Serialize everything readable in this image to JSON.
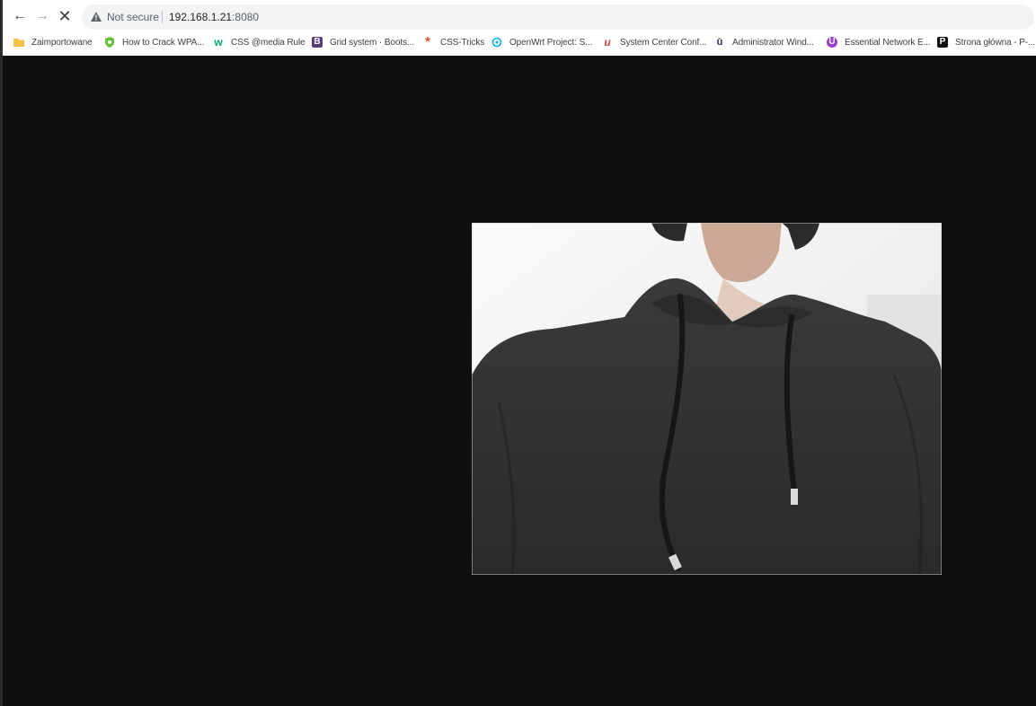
{
  "browser": {
    "security_label": "Not secure",
    "url_host": "192.168.1.21",
    "url_port": ":8080",
    "bookmarks": [
      {
        "label": "Zaimportowane",
        "icon": "folder-icon",
        "color": "#f6c244"
      },
      {
        "label": "How to Crack WPA...",
        "icon": "green-shield-icon",
        "color": "#6abf3a"
      },
      {
        "label": "CSS @media Rule",
        "icon": "w3schools-icon",
        "color": "#04aa6d"
      },
      {
        "label": "Grid system · Boots...",
        "icon": "bootstrap-icon",
        "color": "#563d7c"
      },
      {
        "label": "CSS-Tricks",
        "icon": "asterisk-icon",
        "color": "#e8542c"
      },
      {
        "label": "OpenWrt Project: S...",
        "icon": "openwrt-icon",
        "color": "#00b5e2"
      },
      {
        "label": "System Center Conf...",
        "icon": "red-u-icon",
        "color": "#e03b3b"
      },
      {
        "label": "Administrator Wind...",
        "icon": "u-badge-icon",
        "color": "#2b2b5c"
      },
      {
        "label": "Essential Network E...",
        "icon": "purple-u-icon",
        "color": "#9b3ec8"
      },
      {
        "label": "Strona główna - P-...",
        "icon": "p-square-icon",
        "color": "#111111"
      }
    ]
  }
}
